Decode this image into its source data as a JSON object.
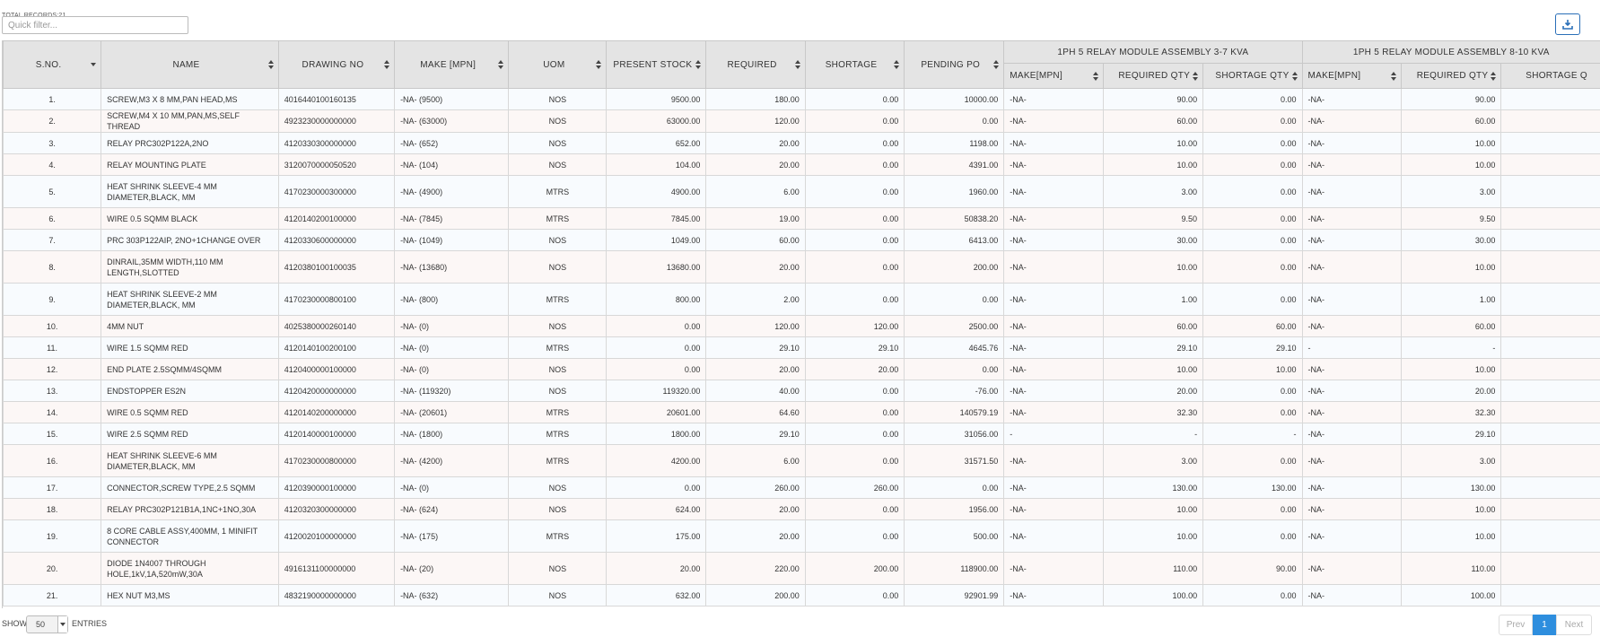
{
  "header": {
    "total_label": "TOTAL RECORDS:",
    "total_count": "21",
    "filter_placeholder": "Quick filter..."
  },
  "columns": {
    "sno": "S.NO.",
    "name": "NAME",
    "drawing": "DRAWING NO",
    "make": "MAKE [MPN]",
    "uom": "UOM",
    "stock": "PRESENT STOCK",
    "required": "REQUIRED",
    "shortage": "SHORTAGE",
    "pending": "PENDING PO",
    "group1": "1PH 5 RELAY MODULE ASSEMBLY 3-7 KVA",
    "group2": "1PH 5 RELAY MODULE ASSEMBLY 8-10 KVA",
    "sub_make": "MAKE[MPN]",
    "sub_req": "REQUIRED QTY",
    "sub_short": "SHORTAGE QTY",
    "sub_short_cut": "SHORTAGE Q"
  },
  "rows": [
    [
      "1.",
      "SCREW,M3 X 8 MM,PAN HEAD,MS",
      "4016440100160135",
      "-NA- (9500)",
      "NOS",
      "9500.00",
      "180.00",
      "0.00",
      "10000.00",
      "-NA-",
      "90.00",
      "0.00",
      "-NA-",
      "90.00"
    ],
    [
      "2.",
      "SCREW,M4 X 10 MM,PAN,MS,SELF THREAD",
      "4923230000000000",
      "-NA- (63000)",
      "NOS",
      "63000.00",
      "120.00",
      "0.00",
      "0.00",
      "-NA-",
      "60.00",
      "0.00",
      "-NA-",
      "60.00"
    ],
    [
      "3.",
      "RELAY PRC302P122A,2NO",
      "4120330300000000",
      "-NA- (652)",
      "NOS",
      "652.00",
      "20.00",
      "0.00",
      "1198.00",
      "-NA-",
      "10.00",
      "0.00",
      "-NA-",
      "10.00"
    ],
    [
      "4.",
      "RELAY MOUNTING PLATE",
      "3120070000050520",
      "-NA- (104)",
      "NOS",
      "104.00",
      "20.00",
      "0.00",
      "4391.00",
      "-NA-",
      "10.00",
      "0.00",
      "-NA-",
      "10.00"
    ],
    [
      "5.",
      "HEAT SHRINK SLEEVE-4 MM DIAMETER,BLACK, MM",
      "4170230000300000",
      "-NA- (4900)",
      "MTRS",
      "4900.00",
      "6.00",
      "0.00",
      "1960.00",
      "-NA-",
      "3.00",
      "0.00",
      "-NA-",
      "3.00"
    ],
    [
      "6.",
      "WIRE 0.5 SQMM BLACK",
      "4120140200100000",
      "-NA- (7845)",
      "MTRS",
      "7845.00",
      "19.00",
      "0.00",
      "50838.20",
      "-NA-",
      "9.50",
      "0.00",
      "-NA-",
      "9.50"
    ],
    [
      "7.",
      "PRC 303P122AIP, 2NO+1CHANGE OVER",
      "4120330600000000",
      "-NA- (1049)",
      "NOS",
      "1049.00",
      "60.00",
      "0.00",
      "6413.00",
      "-NA-",
      "30.00",
      "0.00",
      "-NA-",
      "30.00"
    ],
    [
      "8.",
      "DINRAIL,35MM WIDTH,110 MM LENGTH,SLOTTED",
      "4120380100100035",
      "-NA- (13680)",
      "NOS",
      "13680.00",
      "20.00",
      "0.00",
      "200.00",
      "-NA-",
      "10.00",
      "0.00",
      "-NA-",
      "10.00"
    ],
    [
      "9.",
      "HEAT SHRINK SLEEVE-2 MM DIAMETER,BLACK, MM",
      "4170230000800100",
      "-NA- (800)",
      "MTRS",
      "800.00",
      "2.00",
      "0.00",
      "0.00",
      "-NA-",
      "1.00",
      "0.00",
      "-NA-",
      "1.00"
    ],
    [
      "10.",
      "4MM NUT",
      "4025380000260140",
      "-NA- (0)",
      "NOS",
      "0.00",
      "120.00",
      "120.00",
      "2500.00",
      "-NA-",
      "60.00",
      "60.00",
      "-NA-",
      "60.00"
    ],
    [
      "11.",
      "WIRE 1.5 SQMM RED",
      "4120140100200100",
      "-NA- (0)",
      "MTRS",
      "0.00",
      "29.10",
      "29.10",
      "4645.76",
      "-NA-",
      "29.10",
      "29.10",
      "-",
      "-"
    ],
    [
      "12.",
      "END PLATE 2.5SQMM/4SQMM",
      "4120400000100000",
      "-NA- (0)",
      "NOS",
      "0.00",
      "20.00",
      "20.00",
      "0.00",
      "-NA-",
      "10.00",
      "10.00",
      "-NA-",
      "10.00"
    ],
    [
      "13.",
      "ENDSTOPPER ES2N",
      "4120420000000000",
      "-NA- (119320)",
      "NOS",
      "119320.00",
      "40.00",
      "0.00",
      "-76.00",
      "-NA-",
      "20.00",
      "0.00",
      "-NA-",
      "20.00"
    ],
    [
      "14.",
      "WIRE 0.5 SQMM RED",
      "4120140200000000",
      "-NA- (20601)",
      "MTRS",
      "20601.00",
      "64.60",
      "0.00",
      "140579.19",
      "-NA-",
      "32.30",
      "0.00",
      "-NA-",
      "32.30"
    ],
    [
      "15.",
      "WIRE 2.5 SQMM RED",
      "4120140000100000",
      "-NA- (1800)",
      "MTRS",
      "1800.00",
      "29.10",
      "0.00",
      "31056.00",
      "-",
      "-",
      "-",
      "-NA-",
      "29.10"
    ],
    [
      "16.",
      "HEAT SHRINK SLEEVE-6 MM DIAMETER,BLACK, MM",
      "4170230000800000",
      "-NA- (4200)",
      "MTRS",
      "4200.00",
      "6.00",
      "0.00",
      "31571.50",
      "-NA-",
      "3.00",
      "0.00",
      "-NA-",
      "3.00"
    ],
    [
      "17.",
      "CONNECTOR,SCREW TYPE,2.5 SQMM",
      "4120390000100000",
      "-NA- (0)",
      "NOS",
      "0.00",
      "260.00",
      "260.00",
      "0.00",
      "-NA-",
      "130.00",
      "130.00",
      "-NA-",
      "130.00"
    ],
    [
      "18.",
      "RELAY PRC302P121B1A,1NC+1NO,30A",
      "4120320300000000",
      "-NA- (624)",
      "NOS",
      "624.00",
      "20.00",
      "0.00",
      "1956.00",
      "-NA-",
      "10.00",
      "0.00",
      "-NA-",
      "10.00"
    ],
    [
      "19.",
      "8 CORE CABLE ASSY,400MM, 1 MINIFIT CONNECTOR",
      "4120020100000000",
      "-NA- (175)",
      "MTRS",
      "175.00",
      "20.00",
      "0.00",
      "500.00",
      "-NA-",
      "10.00",
      "0.00",
      "-NA-",
      "10.00"
    ],
    [
      "20.",
      "DIODE 1N4007 THROUGH HOLE,1kV,1A,520mW,30A",
      "4916131100000000",
      "-NA- (20)",
      "NOS",
      "20.00",
      "220.00",
      "200.00",
      "118900.00",
      "-NA-",
      "110.00",
      "90.00",
      "-NA-",
      "110.00"
    ],
    [
      "21.",
      "HEX NUT M3,MS",
      "4832190000000000",
      "-NA- (632)",
      "NOS",
      "632.00",
      "200.00",
      "0.00",
      "92901.99",
      "-NA-",
      "100.00",
      "0.00",
      "-NA-",
      "100.00"
    ]
  ],
  "footer": {
    "show_label": "SHOW",
    "page_size": "50",
    "entries_label": "ENTRIES",
    "prev": "Prev",
    "page": "1",
    "next": "Next"
  },
  "colors": {
    "accent": "#2e8ede",
    "header_bg": "#e4e4e4"
  }
}
